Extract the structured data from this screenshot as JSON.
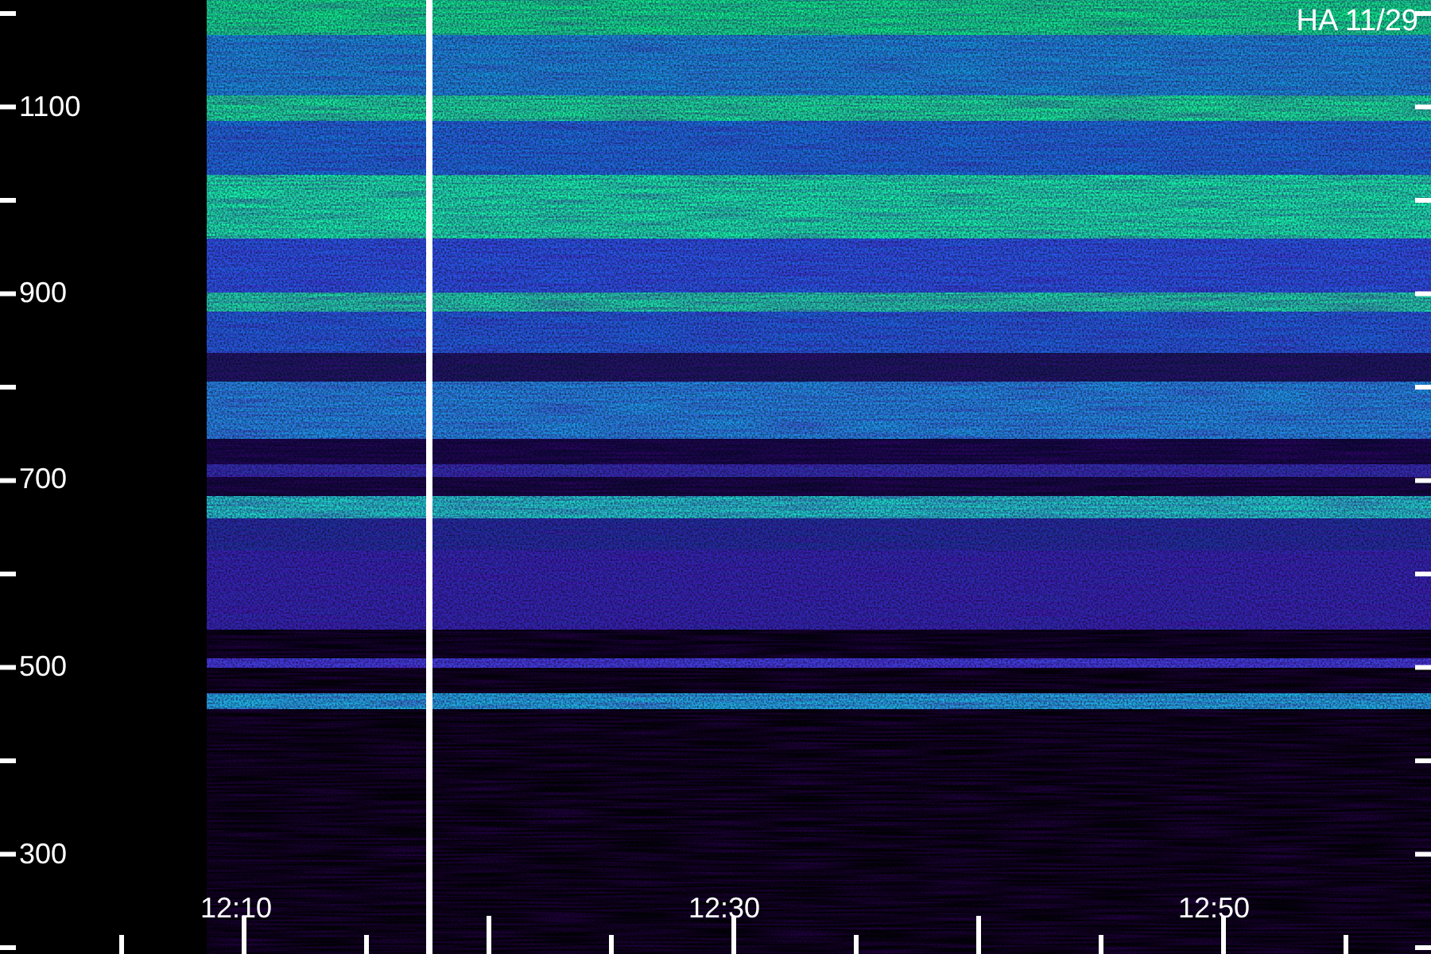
{
  "title": "HA 11/29",
  "y_axis": {
    "labels": [
      "1100",
      "900",
      "700",
      "500",
      "300"
    ]
  },
  "x_axis": {
    "labels": [
      "12:10",
      "12:30",
      "12:50"
    ]
  }
}
